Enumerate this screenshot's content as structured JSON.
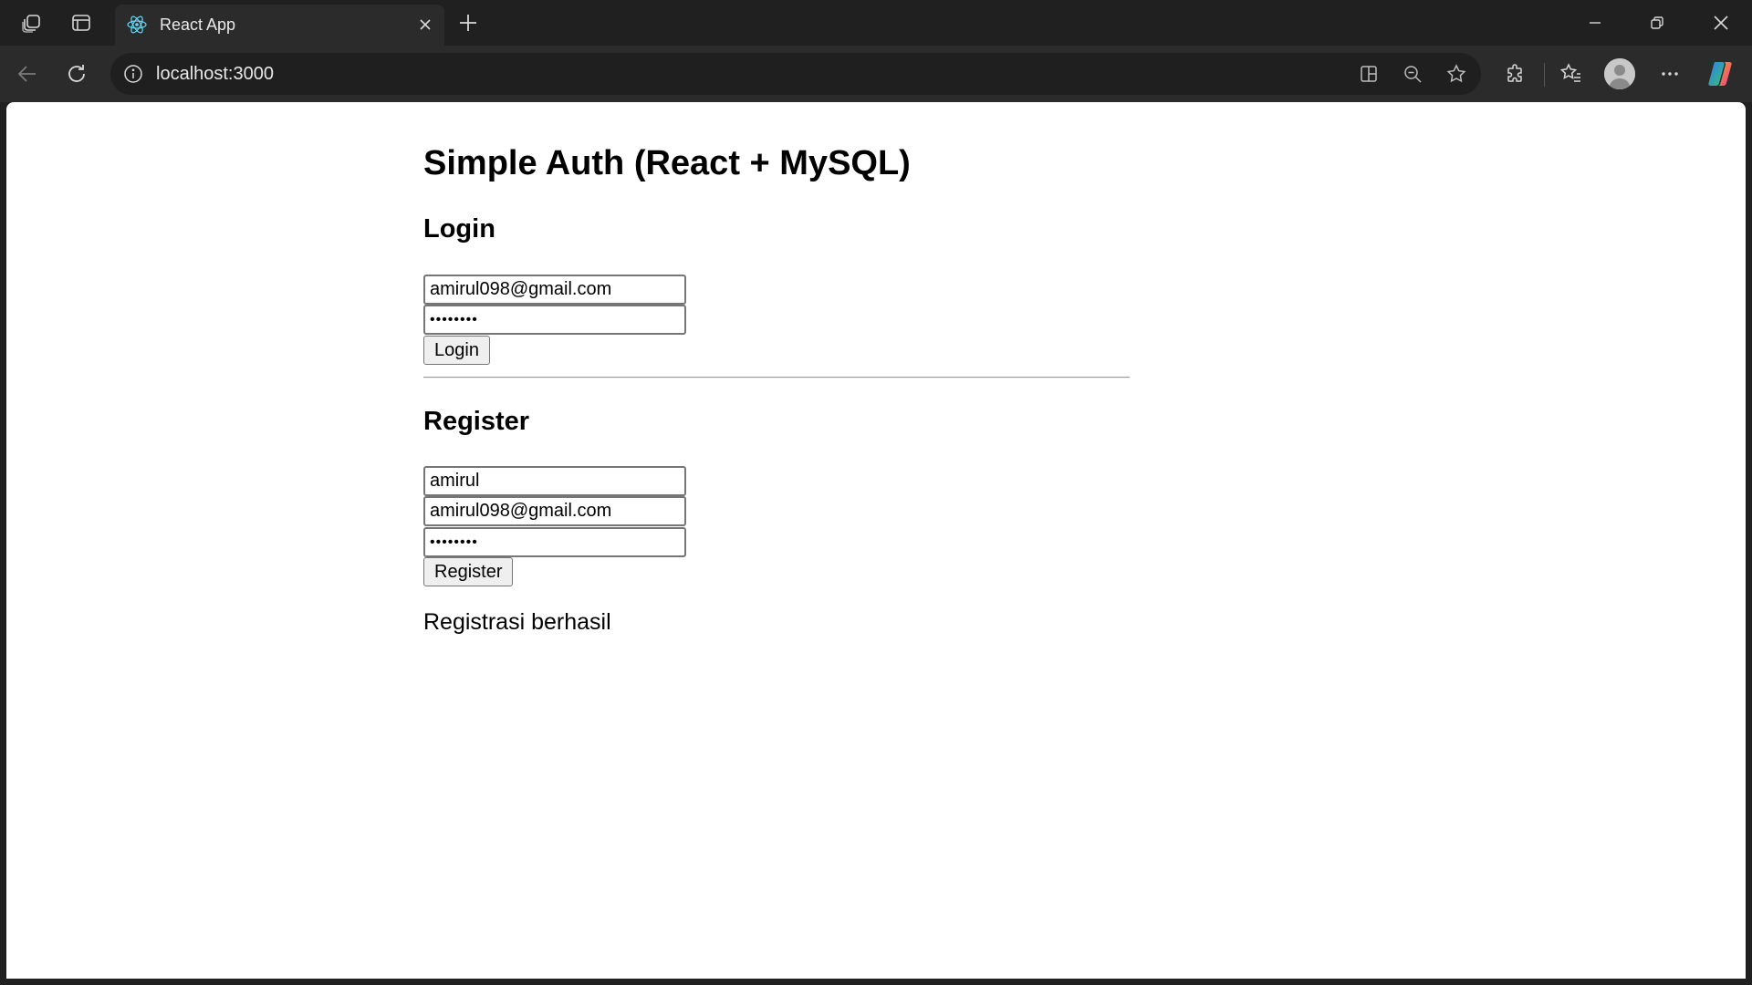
{
  "browser": {
    "tab": {
      "title": "React App",
      "favicon": "react-logo-icon"
    },
    "url": "localhost:3000",
    "colors": {
      "chrome": "#202020",
      "toolbar": "#2b2b2b",
      "omnibox": "#1f1f1f"
    }
  },
  "page": {
    "title": "Simple Auth (React + MySQL)",
    "login": {
      "heading": "Login",
      "email": "amirul098@gmail.com",
      "password": "••••••••",
      "button": "Login"
    },
    "register": {
      "heading": "Register",
      "name": "amirul",
      "email": "amirul098@gmail.com",
      "password": "••••••••",
      "button": "Register"
    },
    "message": "Registrasi berhasil"
  }
}
